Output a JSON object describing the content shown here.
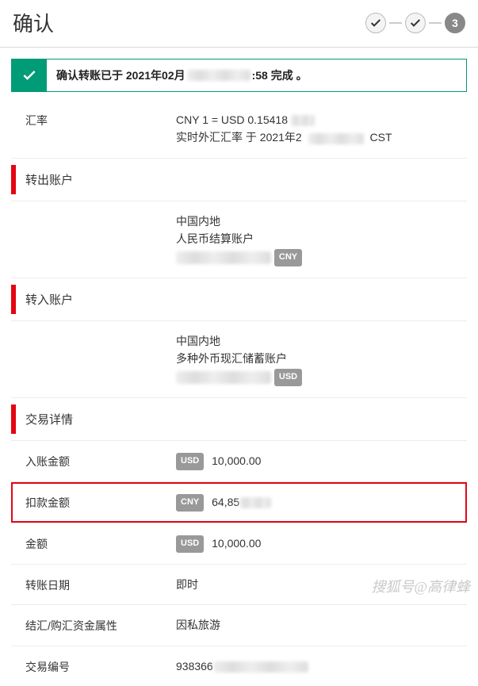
{
  "header": {
    "title": "确认",
    "steps": {
      "done1": "✓",
      "done2": "✓",
      "current": "3"
    }
  },
  "banner": {
    "prefix": "确认转账已于 2021年02月",
    "suffix": ":58 完成 。"
  },
  "rate": {
    "label": "汇率",
    "line1": "CNY 1 = USD 0.15418",
    "line2_prefix": "实时外汇汇率 于 2021年2",
    "line2_suffix": "CST"
  },
  "from": {
    "section": "转出账户",
    "region": "中国内地",
    "accType": "人民币结算账户",
    "currency": "CNY"
  },
  "to": {
    "section": "转入账户",
    "region": "中国内地",
    "accType": "多种外币现汇储蓄账户",
    "currency": "USD"
  },
  "details": {
    "section": "交易详情",
    "creditLabel": "入账金额",
    "creditCur": "USD",
    "creditVal": "10,000.00",
    "debitLabel": "扣款金额",
    "debitCur": "CNY",
    "debitVal": "64,85",
    "amountLabel": "金额",
    "amountCur": "USD",
    "amountVal": "10,000.00",
    "dateLabel": "转账日期",
    "dateVal": "即时",
    "purposeLabel": "结汇/购汇资金属性",
    "purposeVal": "因私旅游",
    "refLabel": "交易编号",
    "refVal": "938366"
  },
  "watermark": "搜狐号@高律蜂"
}
